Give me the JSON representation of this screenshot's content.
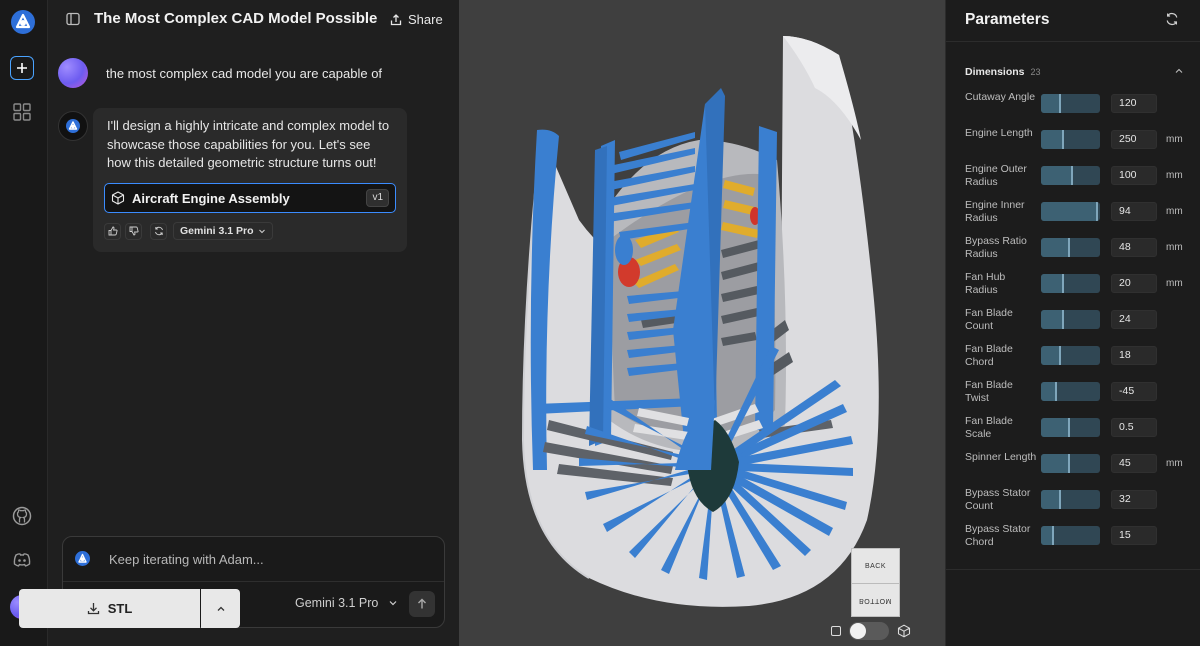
{
  "chat": {
    "title": "The Most Complex CAD Model Possible",
    "share_label": "Share",
    "user_message": "the most complex cad model you are capable of",
    "bot_message": "I'll design a highly intricate and complex model to showcase those capabilities for you. Let's see how this detailed geometric structure turns out!",
    "artifact": {
      "label": "Aircraft Engine Assembly",
      "version": "v1"
    },
    "message_model": "Gemini 3.1 Pro"
  },
  "composer": {
    "placeholder": "Keep iterating with Adam...",
    "model": "Gemini 3.1 Pro"
  },
  "viewport": {
    "view_cube": {
      "top": "BACK",
      "bottom": "BOTTOM"
    }
  },
  "parameters": {
    "title": "Parameters",
    "section": {
      "label": "Dimensions",
      "count": "23"
    },
    "rows": [
      {
        "label": "Cutaway Angle",
        "value": "120",
        "unit": "",
        "fill": 0.33
      },
      {
        "label": "Engine Length",
        "value": "250",
        "unit": "mm",
        "fill": 0.38
      },
      {
        "label": "Engine Outer Radius",
        "value": "100",
        "unit": "mm",
        "fill": 0.52
      },
      {
        "label": "Engine Inner Radius",
        "value": "94",
        "unit": "mm",
        "fill": 0.95
      },
      {
        "label": "Bypass Ratio Radius",
        "value": "48",
        "unit": "mm",
        "fill": 0.48
      },
      {
        "label": "Fan Hub Radius",
        "value": "20",
        "unit": "mm",
        "fill": 0.38
      },
      {
        "label": "Fan Blade Count",
        "value": "24",
        "unit": "",
        "fill": 0.38
      },
      {
        "label": "Fan Blade Chord",
        "value": "18",
        "unit": "",
        "fill": 0.33
      },
      {
        "label": "Fan Blade Twist",
        "value": "-45",
        "unit": "",
        "fill": 0.25
      },
      {
        "label": "Fan Blade Scale",
        "value": "0.5",
        "unit": "",
        "fill": 0.48
      },
      {
        "label": "Spinner Length",
        "value": "45",
        "unit": "mm",
        "fill": 0.48
      },
      {
        "label": "Bypass Stator Count",
        "value": "32",
        "unit": "",
        "fill": 0.33
      },
      {
        "label": "Bypass Stator Chord",
        "value": "15",
        "unit": "",
        "fill": 0.2
      }
    ],
    "export_label": "STL"
  },
  "colors": {
    "accent": "#3b8cff",
    "model_blue": "#3a7fd0",
    "model_grey": "#dcdcdf",
    "slider_fill": "#3d6173"
  }
}
